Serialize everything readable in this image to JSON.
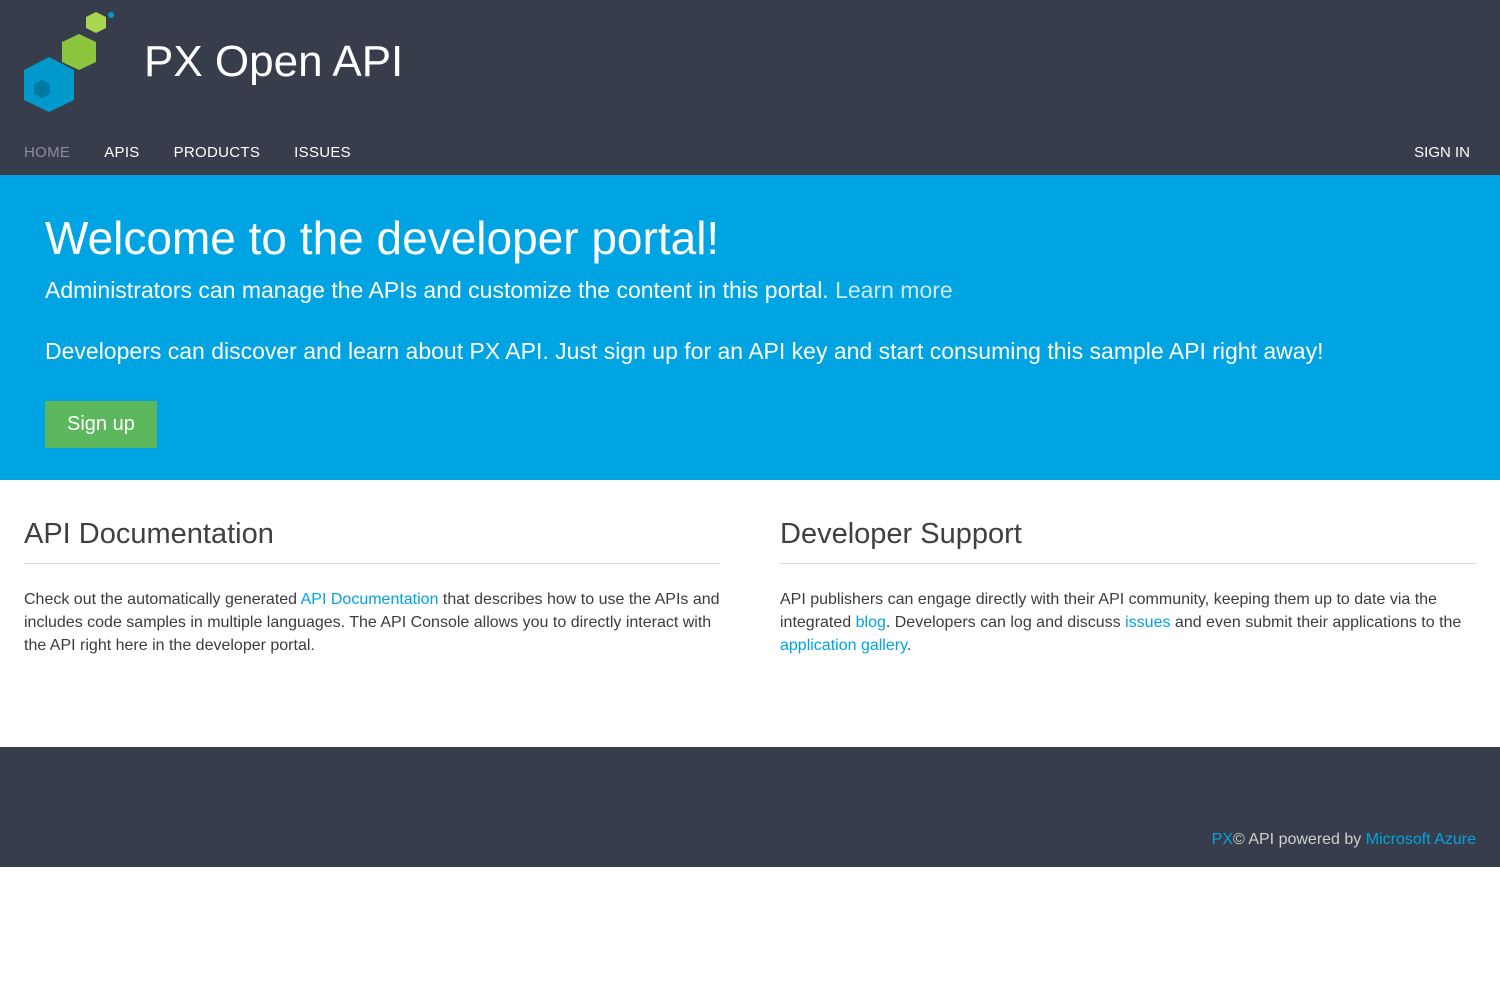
{
  "brand": {
    "title": "PX Open API"
  },
  "nav": {
    "items": [
      {
        "label": "HOME",
        "active": true
      },
      {
        "label": "APIS",
        "active": false
      },
      {
        "label": "PRODUCTS",
        "active": false
      },
      {
        "label": "ISSUES",
        "active": false
      }
    ],
    "signin": "SIGN IN"
  },
  "hero": {
    "title": "Welcome to the developer portal!",
    "sub1_prefix": "Administrators can manage the APIs and customize the content in this portal. ",
    "learn_more": "Learn more",
    "sub2": "Developers can discover and learn about PX API. Just sign up for an API key and start consuming this sample API right away!",
    "signup": "Sign up"
  },
  "columns": {
    "left": {
      "title": "API Documentation",
      "text1": "Check out the automatically generated ",
      "link1": "API Documentation",
      "text2": " that describes how to use the APIs and includes code samples in multiple languages. The API Console allows you to directly interact with the API right here in the developer portal."
    },
    "right": {
      "title": "Developer Support",
      "text1": "API publishers can engage directly with their API community, keeping them up to date via the integrated ",
      "link1": "blog",
      "text2": ". Developers can log and discuss ",
      "link2": "issues",
      "text3": " and even submit their applications to the ",
      "link3": "application gallery",
      "text4": "."
    }
  },
  "footer": {
    "px": "PX",
    "mid": "© API powered by ",
    "azure": "Microsoft Azure"
  }
}
